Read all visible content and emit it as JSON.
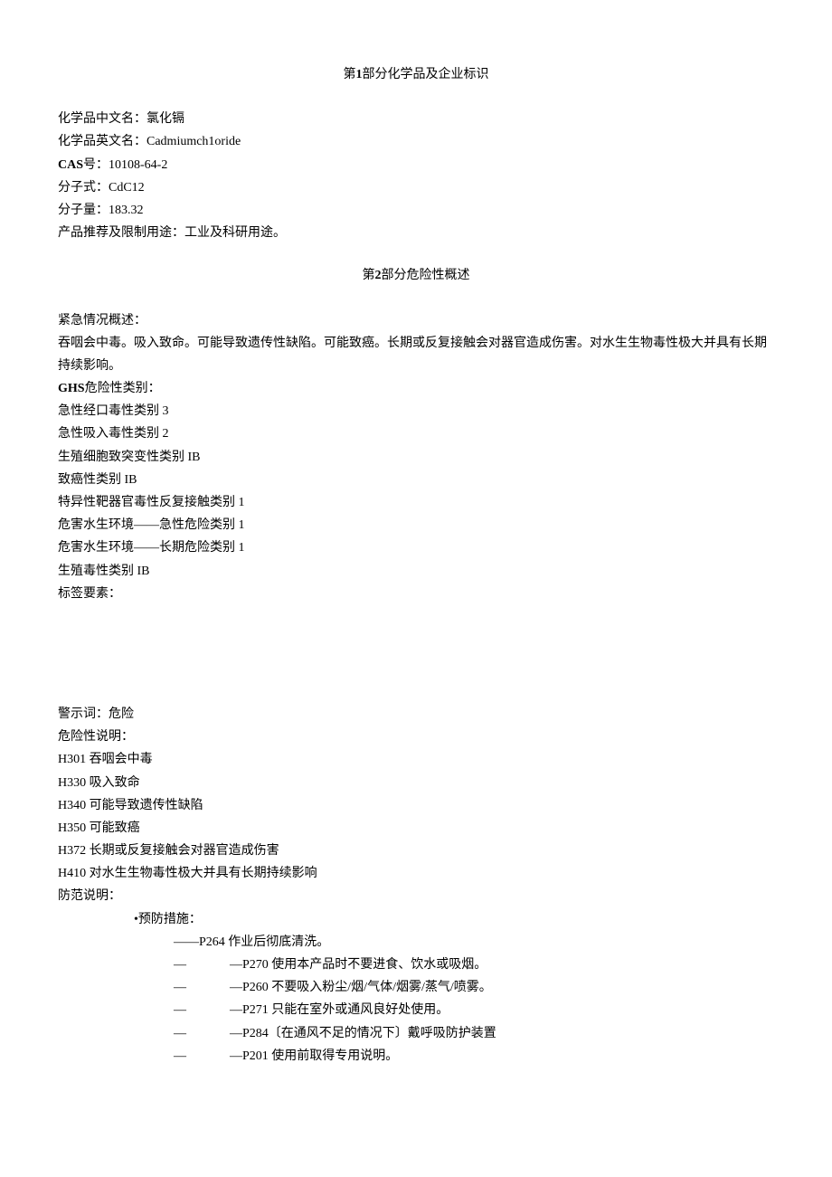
{
  "section1": {
    "title_prefix": "第",
    "title_num": "1",
    "title_suffix": "部分化学品及企业标识",
    "items": {
      "name_cn_label": "化学品中文名：",
      "name_cn_value": "氯化镉",
      "name_en_label": "化学品英文名：",
      "name_en_value": "Cadmiumch1oride",
      "cas_label": "CAS",
      "cas_suffix": "号：",
      "cas_value": "10108-64-2",
      "formula_label": "分子式：",
      "formula_value": "CdC12",
      "mw_label": "分子量：",
      "mw_value": "183.32",
      "use_label": "产品推荐及限制用途：",
      "use_value": "工业及科研用途。"
    }
  },
  "section2": {
    "title_prefix": "第",
    "title_num": "2",
    "title_suffix": "部分危险性概述",
    "emergency": {
      "label": "紧急情况概述：",
      "text": "吞咽会中毒。吸入致命。可能导致遗传性缺陷。可能致癌。长期或反复接触会对器官造成伤害。对水生生物毒性极大并具有长期持续影响。"
    },
    "ghs": {
      "label_prefix": "GHS",
      "label_suffix": "危险性类别：",
      "lines": [
        "急性经口毒性类别 3",
        "急性吸入毒性类别 2",
        "生殖细胞致突变性类别 IB",
        "致癌性类别 IB",
        "特异性靶器官毒性反复接触类别 1",
        "危害水生环境——急性危险类别 1",
        "危害水生环境——长期危险类别 1",
        "生殖毒性类别 IB"
      ],
      "label_elem": "标签要素："
    },
    "signal": {
      "label": "警示词：",
      "value": "危险"
    },
    "hazard": {
      "label": "危险性说明：",
      "lines": [
        "H301 吞咽会中毒",
        "H330 吸入致命",
        "H340 可能导致遗传性缺陷",
        "H350 可能致癌",
        "H372 长期或反复接触会对器官造成伤害",
        "H410 对水生生物毒性极大并具有长期持续影响"
      ]
    },
    "precaution": {
      "label": "防范说明：",
      "bullet": "•预防措施：",
      "first_line": "——P264 作业后彻底清洗。",
      "lines": [
        "—P270 使用本产品时不要进食、饮水或吸烟。",
        "—P260 不要吸入粉尘/烟/气体/烟雾/蒸气/喷雾。",
        "—P271 只能在室外或通风良好处使用。",
        "—P284〔在通风不足的情况下〕戴呼吸防护装置",
        "—P201 使用前取得专用说明。"
      ],
      "dash": "—"
    }
  }
}
